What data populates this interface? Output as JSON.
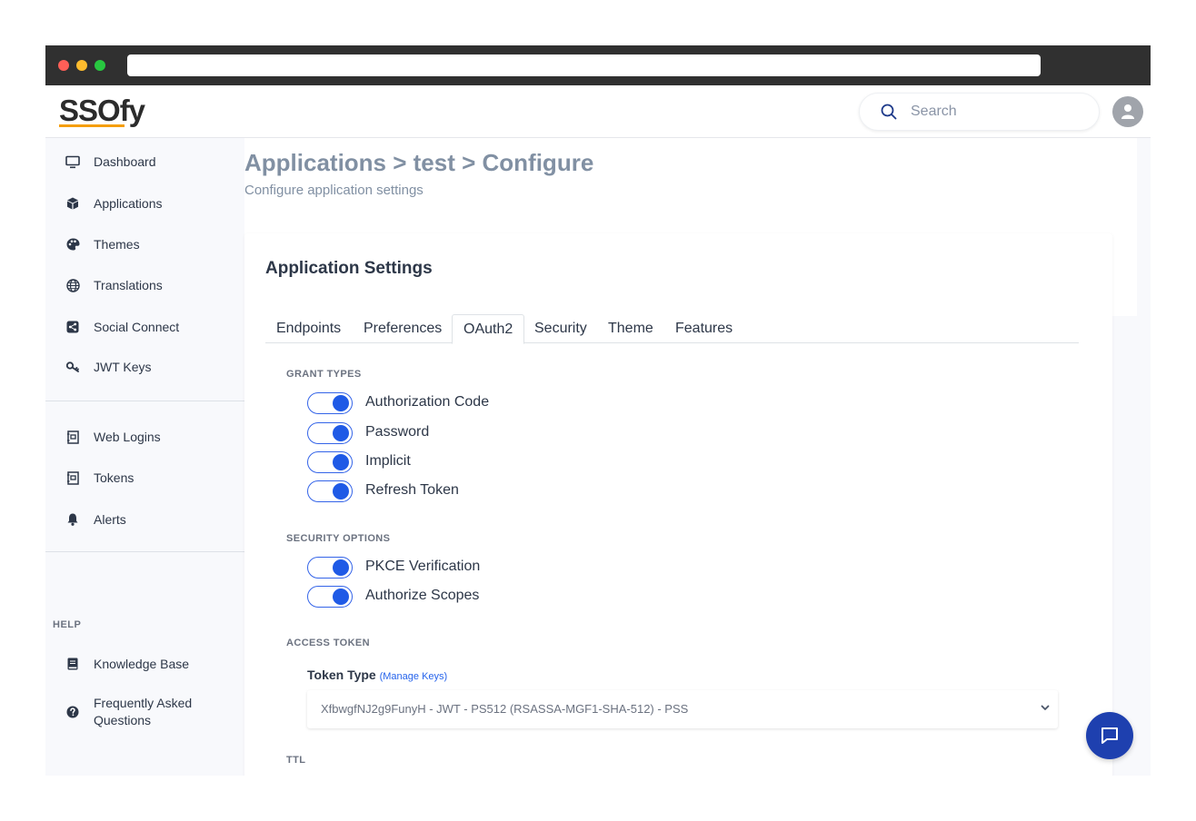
{
  "app": {
    "logo_text": "SSOfy",
    "brand_color": "#f59e0b",
    "accent_color": "#1f5ae6"
  },
  "header": {
    "search": {
      "placeholder": "Search",
      "icon": "search-icon"
    },
    "avatar_icon": "user-icon"
  },
  "sidebar": {
    "items": [
      {
        "label": "Dashboard",
        "icon": "monitor-icon"
      },
      {
        "label": "Applications",
        "icon": "cube-icon"
      },
      {
        "label": "Themes",
        "icon": "palette-icon"
      },
      {
        "label": "Translations",
        "icon": "globe-icon"
      },
      {
        "label": "Social Connect",
        "icon": "share-icon"
      },
      {
        "label": "JWT Keys",
        "icon": "key-icon"
      },
      {
        "label": "Web Logins",
        "icon": "id-card-icon"
      },
      {
        "label": "Tokens",
        "icon": "id-card-icon"
      },
      {
        "label": "Alerts",
        "icon": "bell-icon"
      }
    ],
    "help_heading": "HELP",
    "help_items": [
      {
        "label": "Knowledge Base",
        "icon": "book-icon"
      },
      {
        "label": "Frequently Asked",
        "label_line2": "Questions",
        "icon": "question-circle-icon"
      }
    ]
  },
  "page": {
    "title": "Applications > test > Configure",
    "subtitle": "Configure application settings"
  },
  "card": {
    "title": "Application Settings",
    "tabs": [
      {
        "label": "Endpoints",
        "active": false
      },
      {
        "label": "Preferences",
        "active": false
      },
      {
        "label": "OAuth2",
        "active": true
      },
      {
        "label": "Security",
        "active": false
      },
      {
        "label": "Theme",
        "active": false
      },
      {
        "label": "Features",
        "active": false
      }
    ],
    "grant_types": {
      "label": "GRANT TYPES",
      "items": [
        {
          "label": "Authorization Code",
          "enabled": true
        },
        {
          "label": "Password",
          "enabled": true
        },
        {
          "label": "Implicit",
          "enabled": true
        },
        {
          "label": "Refresh Token",
          "enabled": true
        }
      ]
    },
    "security_options": {
      "label": "SECURITY OPTIONS",
      "items": [
        {
          "label": "PKCE Verification",
          "enabled": true
        },
        {
          "label": "Authorize Scopes",
          "enabled": true
        }
      ]
    },
    "access_token": {
      "label": "ACCESS TOKEN",
      "token_type_label": "Token Type",
      "manage_keys_link": "(Manage Keys)",
      "selected_value": "XfbwgfNJ2g9FunyH - JWT - PS512 (RSASSA-MGF1-SHA-512) - PSS"
    },
    "ttl_label": "TTL"
  },
  "chat_button": {
    "icon": "chat-icon"
  }
}
